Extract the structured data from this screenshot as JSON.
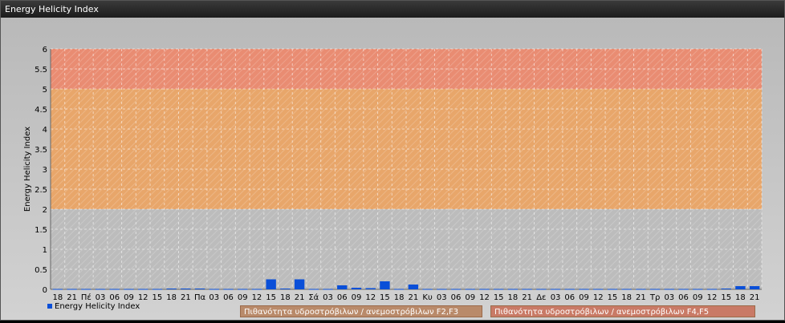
{
  "window": {
    "title": "Energy Helicity Index"
  },
  "colors": {
    "low_band": "#bcbcbc",
    "mid_band": "#e8a66a",
    "high_band": "#e98c72",
    "bar": "#0a4fd8"
  },
  "chart_data": {
    "type": "bar",
    "ylabel": "Energy Helicity Index",
    "ylim": [
      0,
      6
    ],
    "yticks": [
      "0",
      "0.5",
      "1",
      "1.5",
      "2",
      "2.5",
      "3",
      "3.5",
      "4",
      "4.5",
      "5",
      "5.5",
      "6"
    ],
    "bands": [
      {
        "from": 0,
        "to": 2,
        "color": "#bcbcbc"
      },
      {
        "from": 2,
        "to": 5,
        "color": "#e8a66a"
      },
      {
        "from": 5,
        "to": 6,
        "color": "#e98c72"
      }
    ],
    "categories": [
      "18",
      "21",
      "Πέ",
      "03",
      "06",
      "09",
      "12",
      "15",
      "18",
      "21",
      "Πα",
      "03",
      "06",
      "09",
      "12",
      "15",
      "18",
      "21",
      "Σά",
      "03",
      "06",
      "09",
      "12",
      "15",
      "18",
      "21",
      "Κυ",
      "03",
      "06",
      "09",
      "12",
      "15",
      "18",
      "21",
      "Δε",
      "03",
      "06",
      "09",
      "12",
      "15",
      "18",
      "21",
      "Τρ",
      "03",
      "06",
      "09",
      "12",
      "15",
      "18",
      "21"
    ],
    "series": [
      {
        "name": "Energy Helicity Index",
        "values": [
          0.01,
          0.01,
          0.01,
          0.01,
          0.01,
          0.01,
          0.01,
          0.01,
          0.02,
          0.02,
          0.02,
          0.01,
          0.01,
          0.01,
          0.01,
          0.25,
          0.02,
          0.25,
          0.01,
          0.01,
          0.1,
          0.04,
          0.03,
          0.2,
          0.01,
          0.12,
          0.01,
          0.01,
          0.01,
          0.01,
          0.01,
          0.01,
          0.01,
          0.01,
          0.01,
          0.01,
          0.01,
          0.01,
          0.01,
          0.01,
          0.01,
          0.01,
          0.01,
          0.01,
          0.01,
          0.01,
          0.01,
          0.02,
          0.08,
          0.08
        ]
      }
    ],
    "legend": [
      {
        "label": "Energy Helicity Index",
        "color": "#0a4fd8"
      },
      {
        "label": "Πιθανότητα υδροστρόβιλων / ανεμοστρόβιλων F2,F3",
        "color": "#b98a6a"
      },
      {
        "label": "Πιθανότητα υδροστρόβιλων / ανεμοστρόβιλων F4,F5",
        "color": "#c97a66"
      }
    ]
  }
}
